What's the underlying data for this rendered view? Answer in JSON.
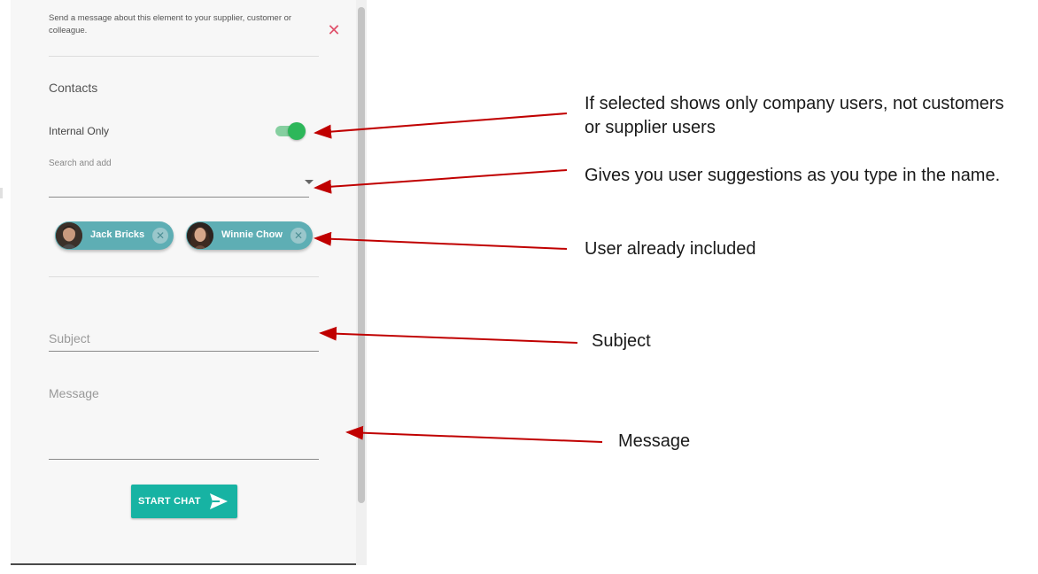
{
  "panel": {
    "intro_text": "Send a message about this element to your supplier, customer or colleague.",
    "close_icon": "close-icon",
    "contacts_title": "Contacts",
    "internal_only_label": "Internal Only",
    "internal_only_on": true,
    "search_label": "Search and add",
    "search_value": "",
    "chips": [
      {
        "name": "Jack Bricks",
        "avatar_icon": "person-avatar"
      },
      {
        "name": "Winnie Chow",
        "avatar_icon": "person-avatar"
      }
    ],
    "subject_placeholder": "Subject",
    "message_placeholder": "Message",
    "start_chat_label": "START CHAT",
    "start_chat_icon": "send-icon"
  },
  "annotations": {
    "internal_only": "If selected shows only company users, not customers or supplier users",
    "search": "Gives you user suggestions as you type in the name.",
    "chips": "User already included",
    "subject": "Subject",
    "message": "Message"
  },
  "colors": {
    "accent_teal": "#17b3a3",
    "chip_teal": "#5eaeb4",
    "toggle_green": "#2db75a",
    "close_red": "#e0506a",
    "arrow_red": "#c00000"
  }
}
